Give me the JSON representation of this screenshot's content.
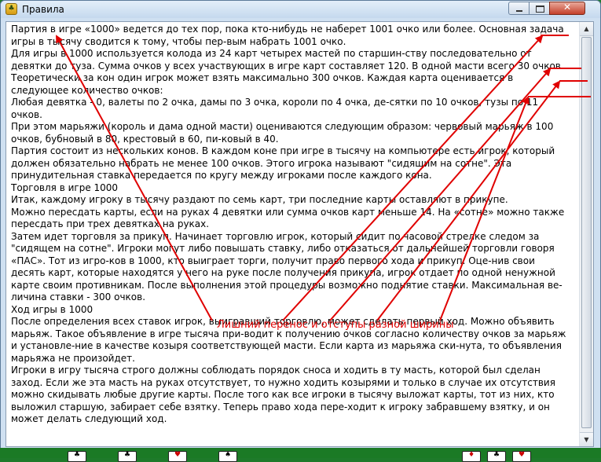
{
  "window": {
    "title": "Правила",
    "app_icon_glyph": "♣",
    "close_glyph": "✕"
  },
  "rules_paragraphs": [
    "   Партия в игре «1000» ведется до тех пор, пока кто-нибудь не наберет 1001 очко или более. Основная задача",
    "игры в тысячу сводится к тому, чтобы пер-вым набрать 1001 очко.",
    "   Для игры в 1000 используется колода из 24 карт четырех мастей по старшин-ству последовательно от девятки до туза. Сумма очков у всех участвующих в игре карт составляет 120. В одной масти всего 30 очков. Теоретически за кон один игрок может взять максимально 300 очков. Каждая карта оценивается в следующее количество очков:",
    "   Любая девятка - 0, валеты по 2 очка, дамы по 3 очка, короли по 4 очка, де-сятки по 10 очков, тузы по 11 очков.",
    "При  этом  марьяжи (король и дама одной масти) оцениваются следующим образом: червовый марьяж в 100 очков, бубновый в 80, крестовый в 60, пи-ковый в 40.",
    "   Партия состоит из нескольких конов. В каждом коне при игре в тысячу на компьютере есть игрок, который должен обязательно набрать не менее 100 очков. Этого игрока называют \"сидящим на сотне\". Эта принудительная ставка передается по кругу между игроками после каждого кона.",
    "   Торговля в игре 1000",
    "   Итак, каждому игроку в тысячу  раздают по семь карт, три последние карты оставляют в прикупе.",
    "Можно пересдать карты, если на руках 4 девятки или сумма очков карт меньше 14. На «сотне» можно также пересдать при трех девятках на руках.",
    "   Затем идет торговля за прикуп. Начинает торговлю игрок, который сидит по часовой стрелке следом за \"сидящем на сотне\". Игроки могут либо повышать ставку, либо отказаться от дальнейшей торговли говоря «ПАС». Тот из игро-ков в 1000, кто выиграет торги, получит право первого хода и прикуп. Оце-нив свои десять карт, которые находятся у него на руке после получения прикупа, игрок отдает по одной ненужной карте своим противникам. После выполнения этой процедуры возможно поднятие ставки. Максимальная ве-личина ставки - 300 очков.",
    "      Ход игры в 1000",
    "   После определения всех ставок игрок, выигравший торговлю, может сделать первый ход.  Можно объявить марьяж. Такое объявление в игре тысяча при-водит к получению очков согласно количеству очков за марьяж и установле-ние в качестве козыря соответствующей масти.  Если карта из марьяжа ски-нута, то объявления марьяжа  не произойдет.",
    "   Игроки в игру тысяча  строго должны соблюдать порядок сноса и ходить в ту масть, которой был сделан заход. Если же эта масть на руках отсутствует, то нужно ходить козырями и только в случае их отсутствия можно скидывать любые другие карты. После того как все игроки в тысячу выложат карты, тот из них, кто выложил старшую, забирает себе взятку. Теперь право хода пере-ходит к игроку забравшему взятку, и он может делать следующий ход."
  ],
  "annotation": {
    "label": "Лишний перенос и отступы разной ширины",
    "color": "#e00000"
  },
  "scrollbar": {
    "up_glyph": "▲",
    "down_glyph": "▼"
  },
  "background_cards": [
    "♣",
    "♣",
    "♥",
    "♠",
    "♦",
    "♣",
    "♥"
  ]
}
